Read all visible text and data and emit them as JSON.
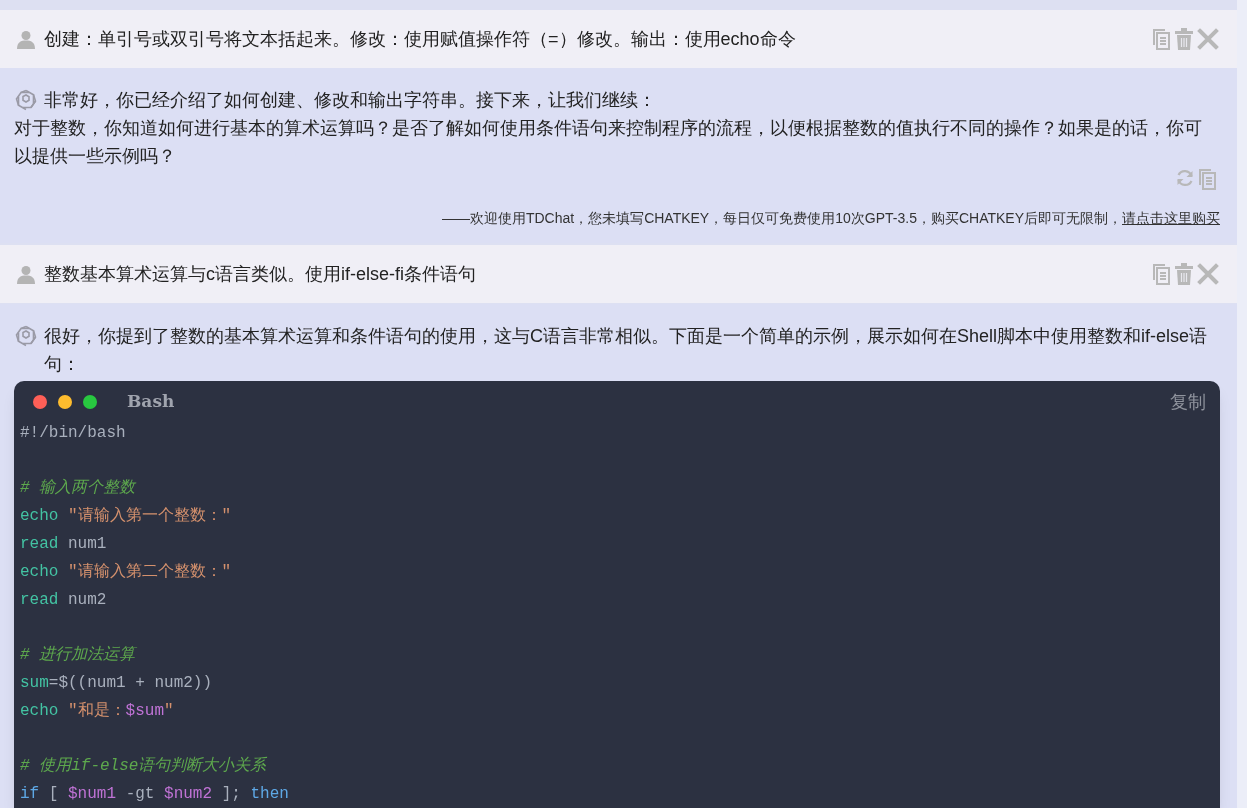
{
  "messages": [
    {
      "kind": "user",
      "text": "创建：单引号或双引号将文本括起来。修改：使用赋值操作符（=）修改。输出：使用echo命令"
    },
    {
      "kind": "assistant",
      "paragraphs": [
        "非常好，你已经介绍了如何创建、修改和输出字符串。接下来，让我们继续：",
        "对于整数，你知道如何进行基本的算术运算吗？是否了解如何使用条件语句来控制程序的流程，以便根据整数的值执行不同的操作？如果是的话，你可以提供一些示例吗？"
      ],
      "footer": {
        "text": "——欢迎使用TDChat，您未填写CHATKEY，每日仅可免费使用10次GPT-3.5，购买CHATKEY后即可无限制，",
        "link": "请点击这里购买"
      }
    },
    {
      "kind": "user",
      "text": "整数基本算术运算与c语言类似。使用if-else-fi条件语句"
    },
    {
      "kind": "assistant",
      "paragraphs": [
        "很好，你提到了整数的基本算术运算和条件语句的使用，这与C语言非常相似。下面是一个简单的示例，展示如何在Shell脚本中使用整数和if-else语句："
      ],
      "code_block": {
        "language": "Bash",
        "copy_label": "复制",
        "blocks": [
          [
            [
              {
                "kind": "plain",
                "text": "#!/bin/bash"
              }
            ]
          ],
          [
            [
              {
                "kind": "comment",
                "text": "# 输入两个整数"
              }
            ],
            [
              {
                "kind": "keyword",
                "text": "echo"
              },
              {
                "kind": "string",
                "text": " \"请输入第一个整数：\""
              }
            ],
            [
              {
                "kind": "keyword",
                "text": "read"
              },
              {
                "kind": "plain",
                "text": " num1"
              }
            ],
            [
              {
                "kind": "keyword",
                "text": "echo"
              },
              {
                "kind": "string",
                "text": " \"请输入第二个整数：\""
              }
            ],
            [
              {
                "kind": "keyword",
                "text": "read"
              },
              {
                "kind": "plain",
                "text": " num2"
              }
            ]
          ],
          [
            [
              {
                "kind": "comment",
                "text": "# 进行加法运算"
              }
            ],
            [
              {
                "kind": "keyword",
                "text": "sum"
              },
              {
                "kind": "plain",
                "text": "=$((num1 + num2))"
              }
            ],
            [
              {
                "kind": "keyword",
                "text": "echo"
              },
              {
                "kind": "string",
                "text": " \"和是："
              },
              {
                "kind": "variable",
                "text": "$sum"
              },
              {
                "kind": "string",
                "text": "\""
              }
            ]
          ],
          [
            [
              {
                "kind": "comment",
                "text": "# 使用if-else语句判断大小关系"
              }
            ],
            [
              {
                "kind": "builtin",
                "text": "if"
              },
              {
                "kind": "plain",
                "text": " [ "
              },
              {
                "kind": "variable",
                "text": "$num1"
              },
              {
                "kind": "plain",
                "text": " -gt "
              },
              {
                "kind": "variable",
                "text": "$num2"
              },
              {
                "kind": "plain",
                "text": " ]; "
              },
              {
                "kind": "builtin",
                "text": "then"
              }
            ]
          ]
        ]
      }
    }
  ]
}
